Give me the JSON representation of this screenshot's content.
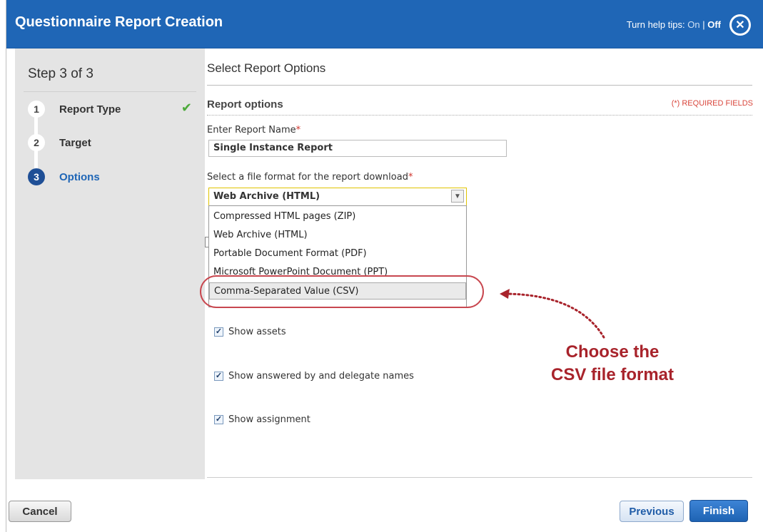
{
  "dialog": {
    "title": "Questionnaire Report Creation",
    "help_tips": {
      "prefix": "Turn help tips:",
      "on": "On",
      "separator": "|",
      "off": "Off"
    },
    "close_icon": "close-icon"
  },
  "sidebar": {
    "step_header": "Step 3 of 3",
    "steps": [
      {
        "number": "1",
        "label": "Report Type",
        "completed": true
      },
      {
        "number": "2",
        "label": "Target",
        "completed": false
      },
      {
        "number": "3",
        "label": "Options",
        "completed": false,
        "active": true
      }
    ]
  },
  "main": {
    "section_title": "Select Report Options",
    "options_header": "Report options",
    "required_note": "(*) REQUIRED FIELDS",
    "report_name": {
      "label": "Enter Report Name",
      "required_mark": "*",
      "value": "Single Instance Report"
    },
    "file_format": {
      "label": "Select a file format for the report download",
      "required_mark": "*",
      "selected": "Web Archive (HTML)",
      "options": [
        "Compressed HTML pages (ZIP)",
        "Web Archive (HTML)",
        "Portable Document Format (PDF)",
        "Microsoft PowerPoint Document (PPT)",
        "Comma-Separated Value (CSV)"
      ],
      "highlighted_option": "Comma-Separated Value (CSV)"
    },
    "checkboxes": [
      {
        "label": "Show assets",
        "checked": true
      },
      {
        "label": "Show answered by and delegate names",
        "checked": true
      },
      {
        "label": "Show assignment",
        "checked": true
      }
    ]
  },
  "annotation": {
    "line1": "Choose the",
    "line2": "CSV file format",
    "color": "#a8232b"
  },
  "footer": {
    "cancel": "Cancel",
    "previous": "Previous",
    "finish": "Finish"
  },
  "colors": {
    "title_bar": "#1f66b6",
    "sidebar_bg": "#e4e4e4",
    "required": "#d0342c"
  }
}
